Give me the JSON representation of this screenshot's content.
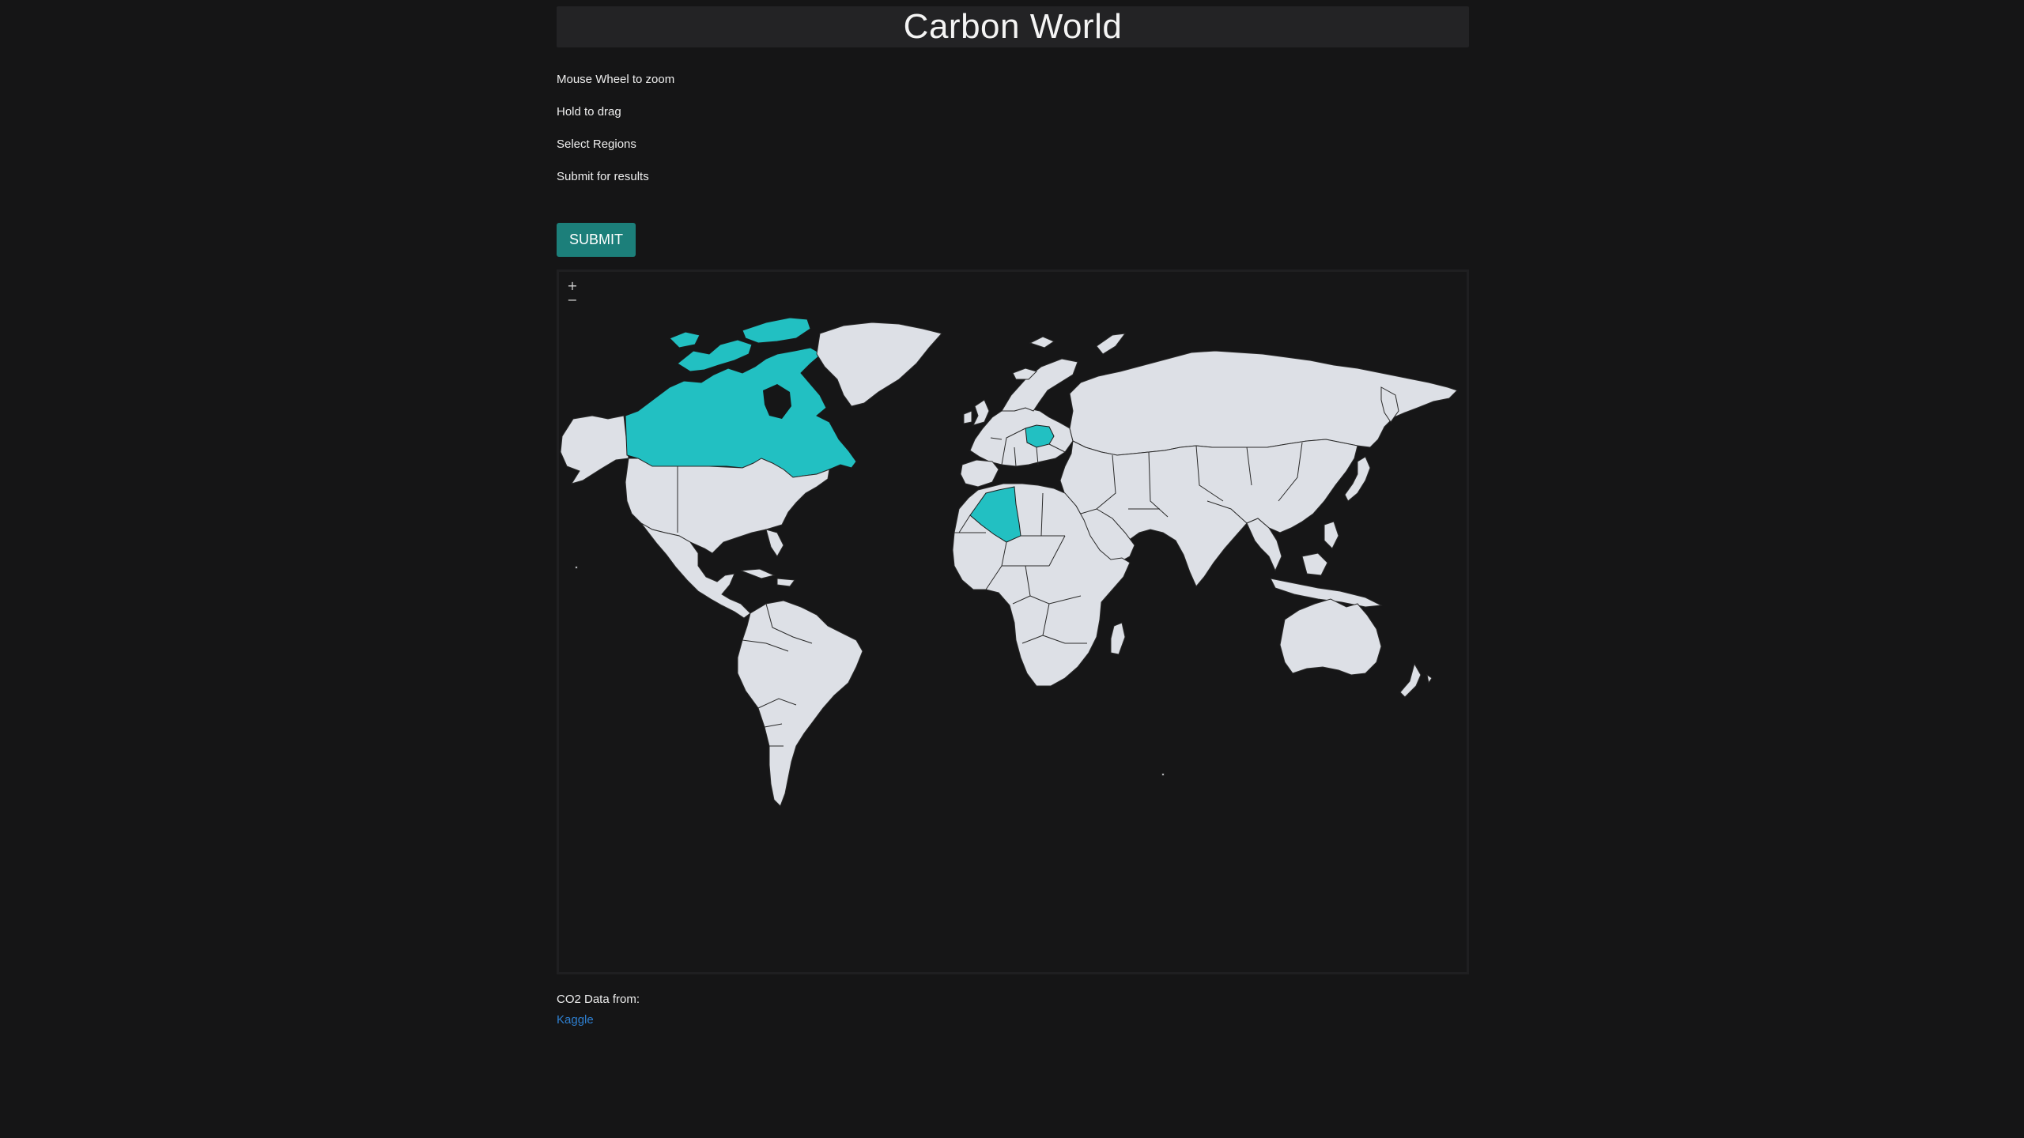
{
  "header": {
    "title": "Carbon World"
  },
  "instructions": [
    "Mouse Wheel to zoom",
    "Hold to drag",
    "Select Regions",
    "Submit for results"
  ],
  "actions": {
    "submit_label": "SUBMIT"
  },
  "map": {
    "zoom_in_label": "+",
    "zoom_out_label": "−",
    "selected_regions": [
      "Canada",
      "Poland",
      "Algeria"
    ],
    "land_color": "#dde0e6",
    "selected_color": "#22c0c2"
  },
  "footer": {
    "source_label": "CO2 Data from:",
    "link_label": "Kaggle"
  }
}
